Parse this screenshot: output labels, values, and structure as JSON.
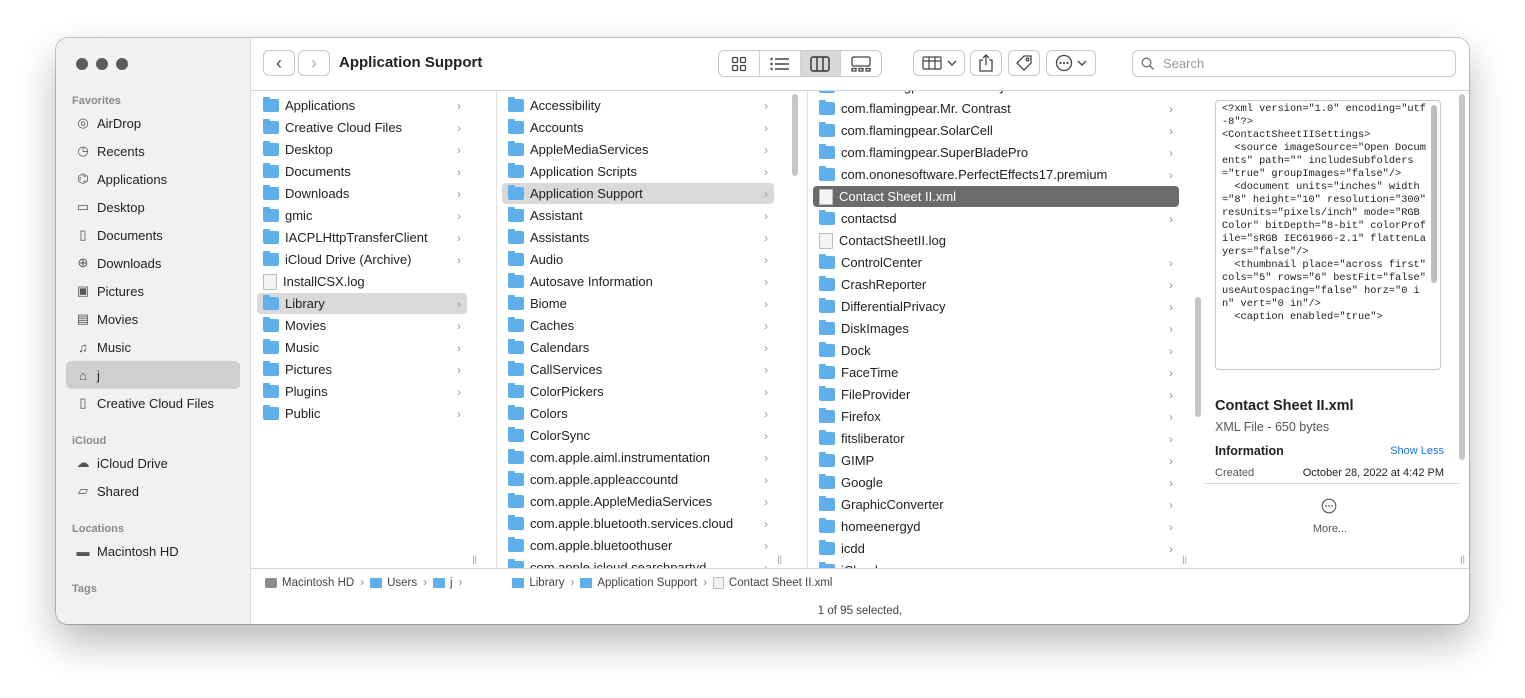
{
  "window": {
    "title": "Application Support"
  },
  "sidebar": {
    "favorites_label": "Favorites",
    "favorites": [
      {
        "label": "AirDrop",
        "icon": "airdrop-icon"
      },
      {
        "label": "Recents",
        "icon": "clock-icon"
      },
      {
        "label": "Applications",
        "icon": "applications-icon"
      },
      {
        "label": "Desktop",
        "icon": "desktop-icon"
      },
      {
        "label": "Documents",
        "icon": "document-icon"
      },
      {
        "label": "Downloads",
        "icon": "download-icon"
      },
      {
        "label": "Pictures",
        "icon": "photo-icon"
      },
      {
        "label": "Movies",
        "icon": "film-icon"
      },
      {
        "label": "Music",
        "icon": "music-note-icon"
      },
      {
        "label": "j",
        "icon": "home-icon"
      },
      {
        "label": "Creative Cloud Files",
        "icon": "document-icon"
      }
    ],
    "icloud_label": "iCloud",
    "icloud": [
      {
        "label": "iCloud Drive",
        "icon": "cloud-icon"
      },
      {
        "label": "Shared",
        "icon": "shared-folder-icon"
      }
    ],
    "locations_label": "Locations",
    "locations": [
      {
        "label": "Macintosh HD",
        "icon": "disk-icon"
      }
    ],
    "tags_label": "Tags"
  },
  "toolbar": {
    "back_label": "‹",
    "forward_label": "›",
    "search_placeholder": "Search"
  },
  "columns": {
    "col1": [
      "Applications",
      "Creative Cloud Files",
      "Desktop",
      "Documents",
      "Downloads",
      "gmic",
      "IACPLHttpTransferClient",
      "iCloud Drive (Archive)",
      "InstallCSX.log",
      "Library",
      "Movies",
      "Music",
      "Pictures",
      "Plugins",
      "Public"
    ],
    "col1_files": [
      "InstallCSX.log"
    ],
    "col1_selected": "Library",
    "col2": [
      "Accessibility",
      "Accounts",
      "AppleMediaServices",
      "Application Scripts",
      "Application Support",
      "Assistant",
      "Assistants",
      "Audio",
      "Autosave Information",
      "Biome",
      "Caches",
      "Calendars",
      "CallServices",
      "ColorPickers",
      "Colors",
      "ColorSync",
      "com.apple.aiml.instrumentation",
      "com.apple.appleaccountd",
      "com.apple.AppleMediaServices",
      "com.apple.bluetooth.services.cloud",
      "com.apple.bluetoothuser",
      "com.apple.icloud.searchpartyd"
    ],
    "col2_selected": "Application Support",
    "col3": [
      "com.flamingpear.Melancholytron",
      "com.flamingpear.Mr. Contrast",
      "com.flamingpear.SolarCell",
      "com.flamingpear.SuperBladePro",
      "com.ononesoftware.PerfectEffects17.premium",
      "Contact Sheet II.xml",
      "contactsd",
      "ContactSheetII.log",
      "ControlCenter",
      "CrashReporter",
      "DifferentialPrivacy",
      "DiskImages",
      "Dock",
      "FaceTime",
      "FileProvider",
      "Firefox",
      "fitsliberator",
      "GIMP",
      "Google",
      "GraphicConverter",
      "homeenergyd",
      "icdd",
      "iCloud"
    ],
    "col3_files": [
      "Contact Sheet II.xml",
      "ContactSheetII.log"
    ],
    "col3_selected": "Contact Sheet II.xml"
  },
  "preview": {
    "xml_text": "<?xml version=\"1.0\" encoding=\"utf-8\"?>\n<ContactSheetIISettings>\n  <source imageSource=\"Open Documents\" path=\"\" includeSubfolders=\"true\" groupImages=\"false\"/>\n  <document units=\"inches\" width=\"8\" height=\"10\" resolution=\"300\" resUnits=\"pixels/inch\" mode=\"RGB Color\" bitDepth=\"8-bit\" colorProfile=\"sRGB IEC61966-2.1\" flattenLayers=\"false\"/>\n  <thumbnail place=\"across first\" cols=\"5\" rows=\"6\" bestFit=\"false\" useAutospacing=\"false\" horz=\"0 in\" vert=\"0 in\"/>\n  <caption enabled=\"true\">",
    "filename": "Contact Sheet II.xml",
    "kind": "XML File - 650 bytes",
    "info_heading": "Information",
    "show_less": "Show Less",
    "created_label": "Created",
    "created_value": "October 28, 2022 at 4:42 PM",
    "more_label": "More..."
  },
  "pathbar": [
    "Macintosh HD",
    "Users",
    "j",
    "Library",
    "Application Support",
    "Contact Sheet II.xml"
  ],
  "status": "1 of 95 selected,",
  "colors": {
    "folder": "#5fb0ea",
    "selected_dark": "#6b6b6b",
    "link": "#1a73d9"
  }
}
